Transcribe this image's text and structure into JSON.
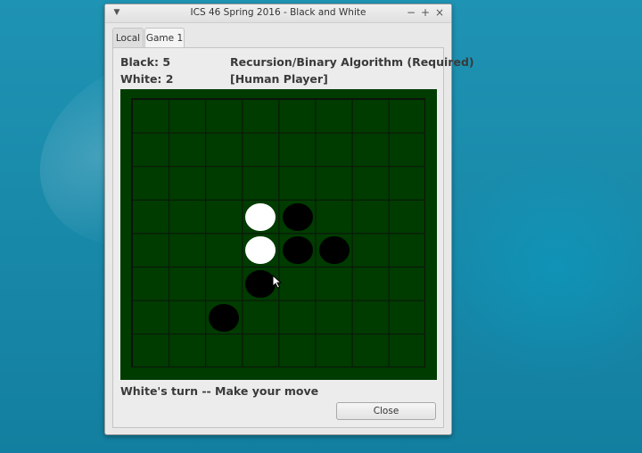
{
  "window": {
    "title": "ICS 46 Spring 2016 - Black and White",
    "menu_icon": "window-menu-icon",
    "controls": {
      "minimize": "−",
      "maximize": "+",
      "close": "×"
    }
  },
  "tabs": [
    {
      "label": "Local",
      "active": false
    },
    {
      "label": "Game 1",
      "active": true
    }
  ],
  "scores": {
    "black": "Black: 5",
    "white": "White: 2"
  },
  "players": {
    "black_player": "Recursion/Binary Algorithm (Required)",
    "white_player": "[Human Player]"
  },
  "board": {
    "size": 8,
    "colors": {
      "felt": "#003b00",
      "lines": "#0c140c",
      "black": "#000000",
      "white": "#ffffff"
    },
    "pieces": [
      {
        "row": 3,
        "col": 3,
        "color": "white"
      },
      {
        "row": 3,
        "col": 4,
        "color": "black"
      },
      {
        "row": 4,
        "col": 3,
        "color": "white"
      },
      {
        "row": 4,
        "col": 4,
        "color": "black"
      },
      {
        "row": 4,
        "col": 5,
        "color": "black"
      },
      {
        "row": 5,
        "col": 3,
        "color": "black"
      },
      {
        "row": 6,
        "col": 2,
        "color": "black"
      }
    ]
  },
  "status": "White's turn -- Make your move",
  "close_button": "Close"
}
